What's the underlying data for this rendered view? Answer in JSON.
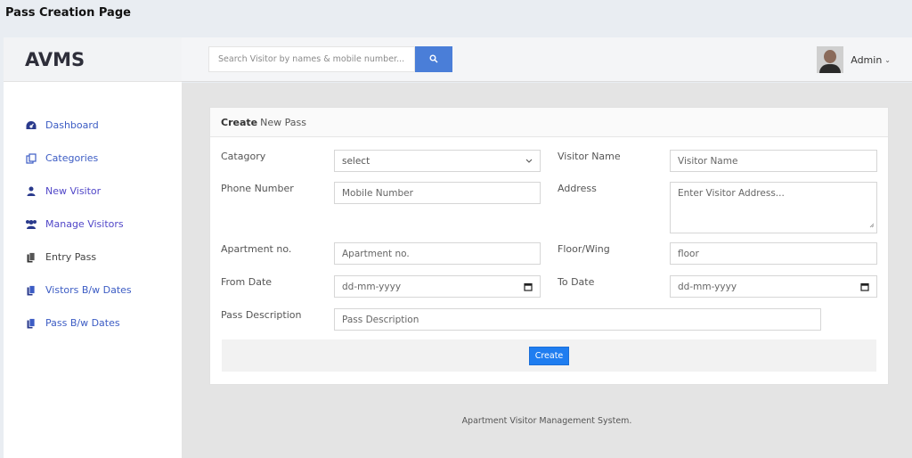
{
  "window": {
    "title": "Pass Creation Page"
  },
  "sidebar": {
    "brand": "AVMS",
    "items": [
      {
        "label": "Dashboard",
        "icon": "dashboard-icon"
      },
      {
        "label": "Categories",
        "icon": "copy-icon"
      },
      {
        "label": "New Visitor",
        "icon": "user-icon"
      },
      {
        "label": "Manage Visitors",
        "icon": "users-icon"
      },
      {
        "label": "Entry Pass",
        "icon": "file-icon"
      },
      {
        "label": "Vistors B/w Dates",
        "icon": "file-icon"
      },
      {
        "label": "Pass B/w Dates",
        "icon": "file-icon"
      }
    ]
  },
  "header": {
    "search": {
      "placeholder": "Search Visitor by names & mobile number..."
    },
    "user": {
      "name": "Admin"
    }
  },
  "form": {
    "title_bold": "Create",
    "title_rest": "New Pass",
    "category": {
      "label": "Catagory",
      "value": "select"
    },
    "visitor_name": {
      "label": "Visitor Name",
      "placeholder": "Visitor Name"
    },
    "phone": {
      "label": "Phone Number",
      "placeholder": "Mobile Number"
    },
    "address": {
      "label": "Address",
      "placeholder": "Enter Visitor Address..."
    },
    "apartment": {
      "label": "Apartment no.",
      "placeholder": "Apartment no."
    },
    "floor": {
      "label": "Floor/Wing",
      "placeholder": "floor"
    },
    "from_date": {
      "label": "From Date",
      "placeholder": "dd-mm-yyyy"
    },
    "to_date": {
      "label": "To Date",
      "placeholder": "dd-mm-yyyy"
    },
    "description": {
      "label": "Pass Description",
      "placeholder": "Pass Description"
    },
    "submit_label": "Create"
  },
  "footer": {
    "text": "Apartment Visitor Management System."
  },
  "colors": {
    "accent": "#4a7ed8",
    "create_button": "#1f7df0",
    "nav_link": "#3c5cc4"
  }
}
